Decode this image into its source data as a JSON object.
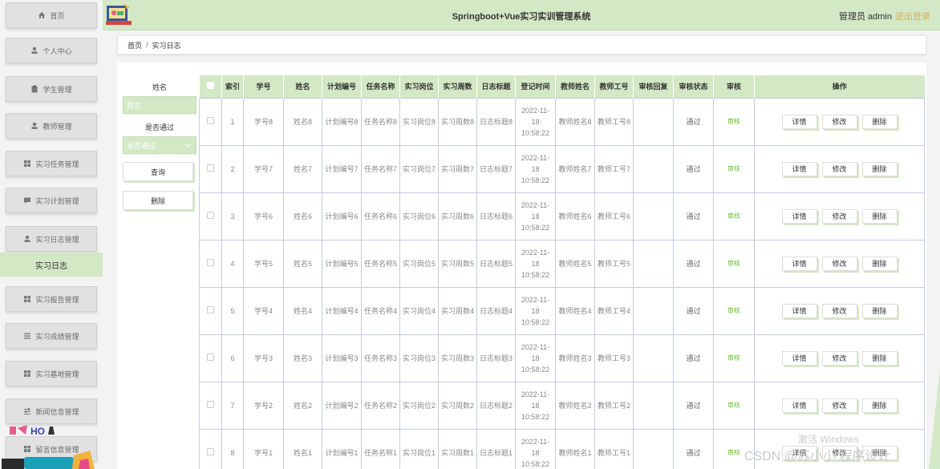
{
  "sidebar": {
    "items": [
      {
        "label": "首页",
        "icon": "home-icon"
      },
      {
        "label": "个人中心",
        "icon": "user-icon"
      },
      {
        "label": "学生管理",
        "icon": "clipboard-icon"
      },
      {
        "label": "教师管理",
        "icon": "user-icon"
      },
      {
        "label": "实习任务管理",
        "icon": "grid-icon"
      },
      {
        "label": "实习计划管理",
        "icon": "chat-icon"
      },
      {
        "label": "实习日志管理",
        "icon": "user-icon"
      },
      {
        "label": "实习报告管理",
        "icon": "grid-icon"
      },
      {
        "label": "实习成绩管理",
        "icon": "list-icon"
      },
      {
        "label": "实习基地管理",
        "icon": "grid-icon"
      },
      {
        "label": "新闻信息管理",
        "icon": "sliders-icon"
      },
      {
        "label": "留言信息管理",
        "icon": "table-icon"
      }
    ],
    "active_submenu": "实习日志"
  },
  "header": {
    "title": "Springboot+Vue实习实训管理系统",
    "user": "管理员 admin",
    "logout": "退出登录"
  },
  "breadcrumb": {
    "home": "首页",
    "separator": "/",
    "current": "实习日志"
  },
  "search": {
    "name_label": "姓名",
    "name_placeholder": "姓名",
    "passed_label": "是否通过",
    "passed_placeholder": "是否通过",
    "query_button": "查询",
    "delete_button": "删除"
  },
  "table": {
    "headers": [
      "索引",
      "学号",
      "姓名",
      "计划编号",
      "任务名称",
      "实习岗位",
      "实习周数",
      "日志标题",
      "登记时间",
      "教师姓名",
      "教师工号",
      "审核回复",
      "审核状态",
      "审核",
      "操作"
    ],
    "rows": [
      {
        "index": "1",
        "student_no": "学号8",
        "name": "姓名8",
        "plan_no": "计划编号8",
        "task": "任务名称8",
        "post": "实习岗位8",
        "weeks": "实习周数8",
        "title": "日志标题8",
        "time": "2022-11-18 10:58:22",
        "teacher": "教师姓名8",
        "teacher_no": "教师工号8",
        "reply": "",
        "status": "通过",
        "audit": "审核"
      },
      {
        "index": "2",
        "student_no": "学号7",
        "name": "姓名7",
        "plan_no": "计划编号7",
        "task": "任务名称7",
        "post": "实习岗位7",
        "weeks": "实习周数7",
        "title": "日志标题7",
        "time": "2022-11-18 10:58:22",
        "teacher": "教师姓名7",
        "teacher_no": "教师工号7",
        "reply": "",
        "status": "通过",
        "audit": "审核"
      },
      {
        "index": "3",
        "student_no": "学号6",
        "name": "姓名6",
        "plan_no": "计划编号6",
        "task": "任务名称6",
        "post": "实习岗位6",
        "weeks": "实习周数6",
        "title": "日志标题6",
        "time": "2022-11-18 10:58:22",
        "teacher": "教师姓名6",
        "teacher_no": "教师工号6",
        "reply": "",
        "status": "通过",
        "audit": "审核"
      },
      {
        "index": "4",
        "student_no": "学号5",
        "name": "姓名5",
        "plan_no": "计划编号5",
        "task": "任务名称5",
        "post": "实习岗位5",
        "weeks": "实习周数5",
        "title": "日志标题5",
        "time": "2022-11-18 10:58:22",
        "teacher": "教师姓名5",
        "teacher_no": "教师工号5",
        "reply": "",
        "status": "通过",
        "audit": "审核"
      },
      {
        "index": "5",
        "student_no": "学号4",
        "name": "姓名4",
        "plan_no": "计划编号4",
        "task": "任务名称4",
        "post": "实习岗位4",
        "weeks": "实习周数4",
        "title": "日志标题4",
        "time": "2022-11-18 10:58:22",
        "teacher": "教师姓名4",
        "teacher_no": "教师工号4",
        "reply": "",
        "status": "通过",
        "audit": "审核"
      },
      {
        "index": "6",
        "student_no": "学号3",
        "name": "姓名3",
        "plan_no": "计划编号3",
        "task": "任务名称3",
        "post": "实习岗位3",
        "weeks": "实习周数3",
        "title": "日志标题3",
        "time": "2022-11-18 10:58:22",
        "teacher": "教师姓名3",
        "teacher_no": "教师工号3",
        "reply": "",
        "status": "通过",
        "audit": "审核"
      },
      {
        "index": "7",
        "student_no": "学号2",
        "name": "姓名2",
        "plan_no": "计划编号2",
        "task": "任务名称2",
        "post": "实习岗位2",
        "weeks": "实习周数2",
        "title": "日志标题2",
        "time": "2022-11-18 10:58:22",
        "teacher": "教师姓名2",
        "teacher_no": "教师工号2",
        "reply": "",
        "status": "通过",
        "audit": "审核"
      },
      {
        "index": "8",
        "student_no": "学号1",
        "name": "姓名1",
        "plan_no": "计划编号1",
        "task": "任务名称1",
        "post": "实习岗位1",
        "weeks": "实习周数1",
        "title": "日志标题1",
        "time": "2022-11-18 10:58:22",
        "teacher": "教师姓名1",
        "teacher_no": "教师工号1",
        "reply": "",
        "status": "通过",
        "audit": "审核"
      }
    ],
    "actions": [
      "详情",
      "修改",
      "删除"
    ]
  },
  "watermarks": {
    "activate": "激活 Windows",
    "csdn": "CSDN @苏小小 程序设计"
  },
  "colors": {
    "accent": "#d3e8c5",
    "sidebar_item": "#e1e1e1",
    "audit_link": "#67c23a",
    "logout": "#d4b25e"
  }
}
